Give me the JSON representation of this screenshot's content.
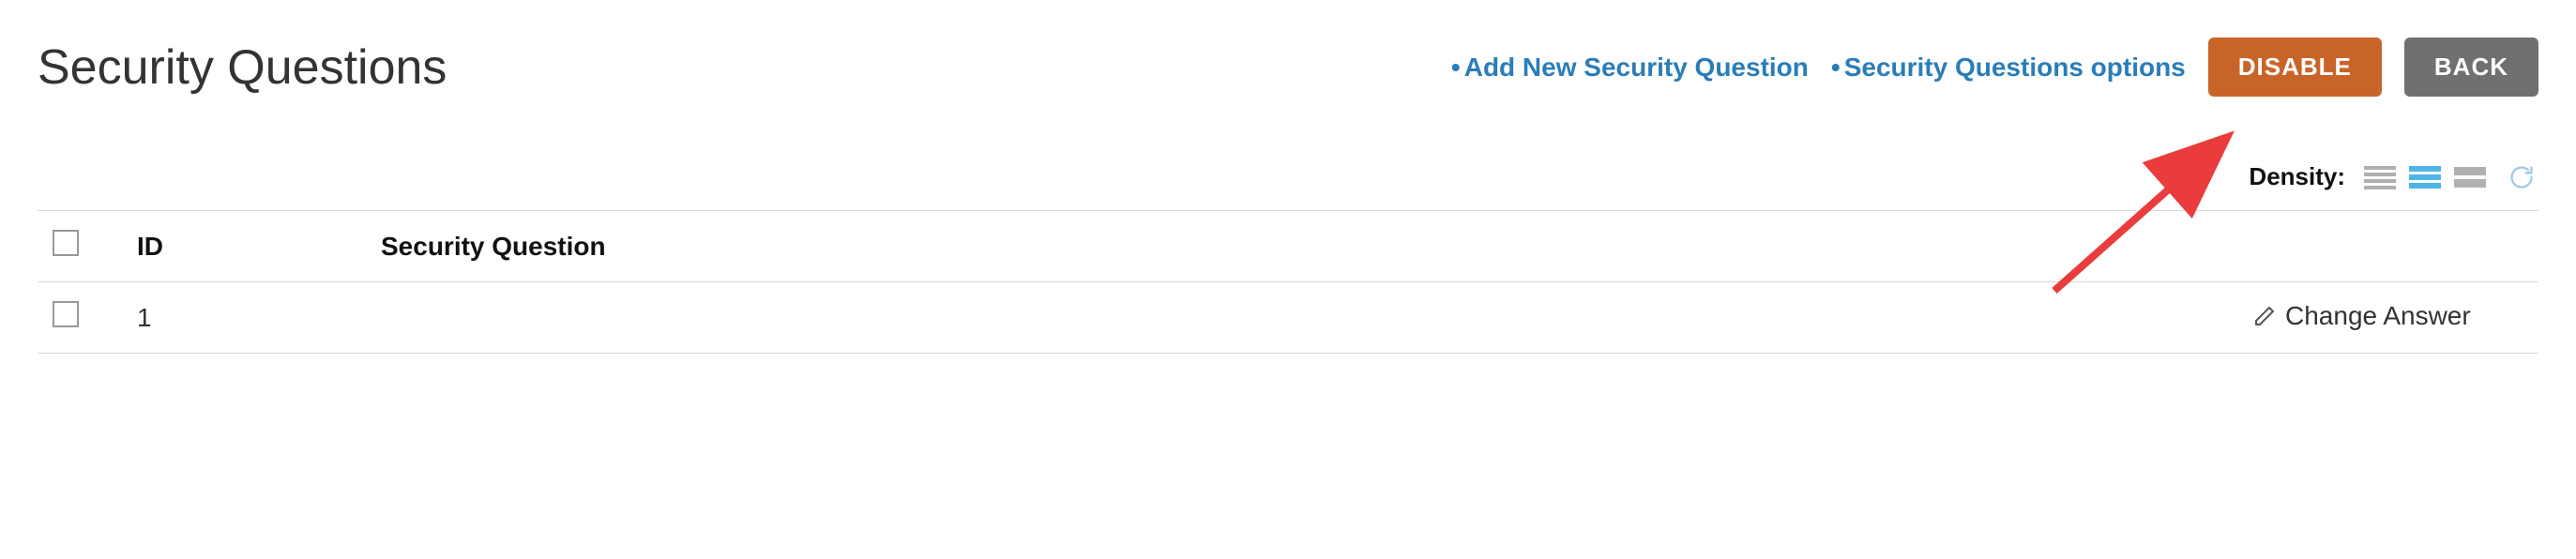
{
  "header": {
    "title": "Security Questions",
    "links": {
      "add_new": "Add New Security Question",
      "options": "Security Questions options"
    },
    "buttons": {
      "disable": "DISABLE",
      "back": "BACK"
    }
  },
  "toolbar": {
    "density_label": "Density:"
  },
  "table": {
    "columns": {
      "id": "ID",
      "question": "Security Question"
    },
    "rows": [
      {
        "id": "1",
        "question": "",
        "action_label": "Change Answer"
      }
    ]
  },
  "colors": {
    "link": "#2a7db8",
    "disable_btn": "#c96428",
    "back_btn": "#707070",
    "density_active": "#4fb4e6",
    "density_inactive": "#b0b0b0",
    "arrow": "#ea3c3c"
  }
}
